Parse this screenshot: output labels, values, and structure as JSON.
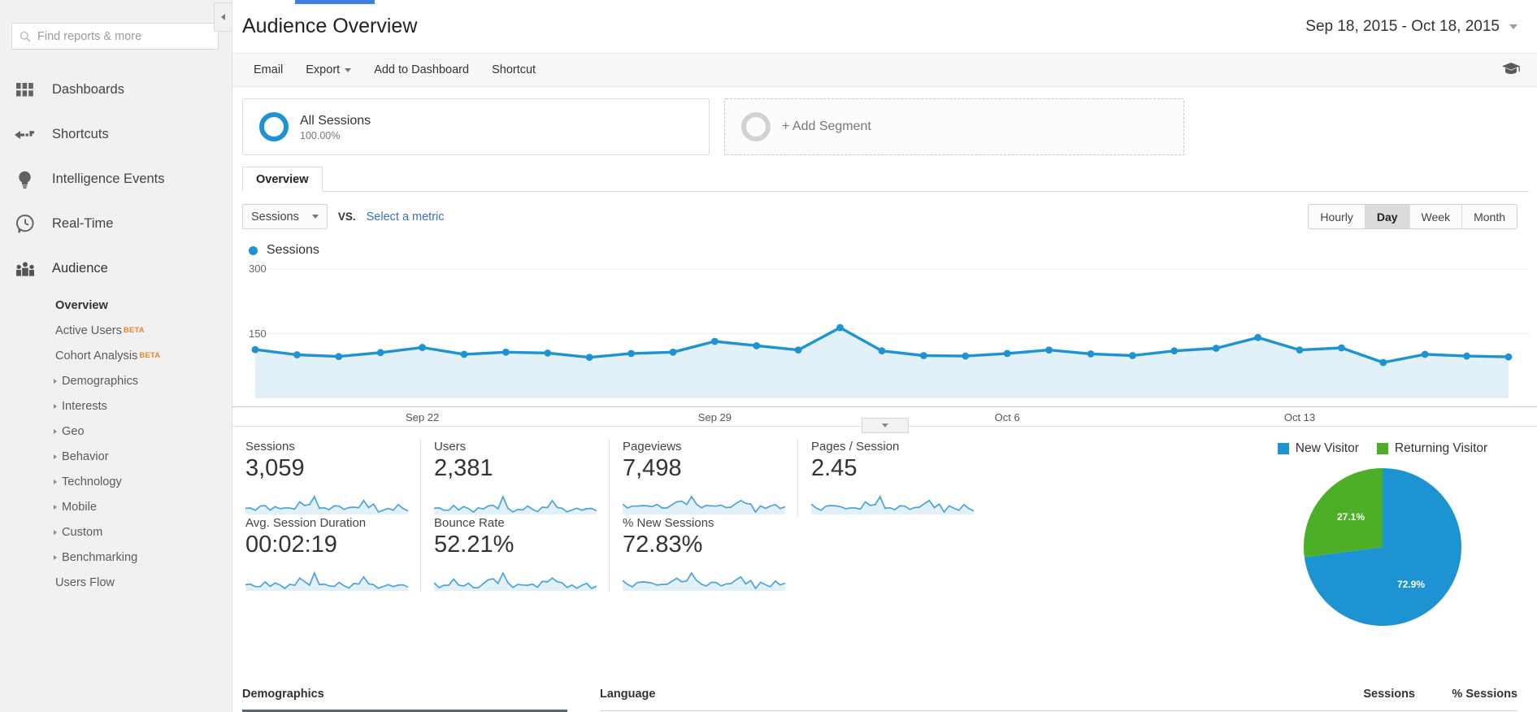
{
  "sidebar": {
    "search": {
      "placeholder": "Find reports & more",
      "value": "",
      "icon": "search-icon"
    },
    "nav": [
      {
        "label": "Dashboards",
        "icon": "grid-icon"
      },
      {
        "label": "Shortcuts",
        "icon": "arrow-left-dashed-icon"
      },
      {
        "label": "Intelligence Events",
        "icon": "lightbulb-icon"
      },
      {
        "label": "Real-Time",
        "icon": "clock-bubble-icon"
      },
      {
        "label": "Audience",
        "icon": "people-icon"
      }
    ],
    "audience_items": [
      {
        "label": "Overview",
        "active": true,
        "beta": "",
        "expandable": false
      },
      {
        "label": "Active Users",
        "active": false,
        "beta": "BETA",
        "expandable": false
      },
      {
        "label": "Cohort Analysis",
        "active": false,
        "beta": "BETA",
        "expandable": false
      },
      {
        "label": "Demographics",
        "active": false,
        "beta": "",
        "expandable": true
      },
      {
        "label": "Interests",
        "active": false,
        "beta": "",
        "expandable": true
      },
      {
        "label": "Geo",
        "active": false,
        "beta": "",
        "expandable": true
      },
      {
        "label": "Behavior",
        "active": false,
        "beta": "",
        "expandable": true
      },
      {
        "label": "Technology",
        "active": false,
        "beta": "",
        "expandable": true
      },
      {
        "label": "Mobile",
        "active": false,
        "beta": "",
        "expandable": true
      },
      {
        "label": "Custom",
        "active": false,
        "beta": "",
        "expandable": true
      },
      {
        "label": "Benchmarking",
        "active": false,
        "beta": "",
        "expandable": true
      },
      {
        "label": "Users Flow",
        "active": false,
        "beta": "",
        "expandable": false
      }
    ]
  },
  "header": {
    "title": "Audience Overview",
    "date_range": "Sep 18, 2015 - Oct 18, 2015",
    "actions": [
      {
        "label": "Email",
        "has_caret": false
      },
      {
        "label": "Export",
        "has_caret": true
      },
      {
        "label": "Add to Dashboard",
        "has_caret": false
      },
      {
        "label": "Shortcut",
        "has_caret": false
      }
    ],
    "help_icon": "graduation-cap-icon"
  },
  "segments": {
    "applied": {
      "name": "All Sessions",
      "percent": "100.00%"
    },
    "add_label": "+ Add Segment"
  },
  "tabs": [
    {
      "label": "Overview",
      "active": true
    }
  ],
  "controls": {
    "metric_selected": "Sessions",
    "vs_label": "VS.",
    "compare_link": "Select a metric",
    "granularity": [
      {
        "label": "Hourly",
        "active": false
      },
      {
        "label": "Day",
        "active": true
      },
      {
        "label": "Week",
        "active": false
      },
      {
        "label": "Month",
        "active": false
      }
    ]
  },
  "chart_data": {
    "type": "line",
    "title": "Sessions",
    "legend": [
      "Sessions"
    ],
    "legend_position": "top-left",
    "xlabel": "",
    "ylabel": "Sessions",
    "ylim": [
      0,
      300
    ],
    "yticks": [
      150,
      300
    ],
    "grid": true,
    "series_color": "#1e93d1",
    "area_fill": "#e2f0f8",
    "x_tick_labels": [
      "Sep 22",
      "Sep 29",
      "Oct 6",
      "Oct 13"
    ],
    "x_tick_indices": [
      4,
      11,
      18,
      25
    ],
    "x": [
      "Sep 18",
      "Sep 19",
      "Sep 20",
      "Sep 21",
      "Sep 22",
      "Sep 23",
      "Sep 24",
      "Sep 25",
      "Sep 26",
      "Sep 27",
      "Sep 28",
      "Sep 29",
      "Sep 30",
      "Oct 1",
      "Oct 2",
      "Oct 3",
      "Oct 4",
      "Oct 5",
      "Oct 6",
      "Oct 7",
      "Oct 8",
      "Oct 9",
      "Oct 10",
      "Oct 11",
      "Oct 12",
      "Oct 13",
      "Oct 14",
      "Oct 15",
      "Oct 16",
      "Oct 17",
      "Oct 18"
    ],
    "values": [
      113,
      101,
      97,
      106,
      118,
      102,
      107,
      105,
      95,
      104,
      107,
      132,
      122,
      112,
      164,
      110,
      99,
      98,
      104,
      112,
      103,
      99,
      110,
      116,
      141,
      112,
      117,
      83,
      102,
      98,
      96
    ]
  },
  "metric_cards": [
    {
      "label": "Sessions",
      "value": "3,059"
    },
    {
      "label": "Users",
      "value": "2,381"
    },
    {
      "label": "Pageviews",
      "value": "7,498"
    },
    {
      "label": "Pages / Session",
      "value": "2.45"
    },
    {
      "label": "Avg. Session Duration",
      "value": "00:02:19"
    },
    {
      "label": "Bounce Rate",
      "value": "52.21%"
    },
    {
      "label": "% New Sessions",
      "value": "72.83%"
    }
  ],
  "visitor_pie": {
    "type": "pie",
    "title": "",
    "categories": [
      "New Visitor",
      "Returning Visitor"
    ],
    "values": [
      72.9,
      27.1
    ],
    "labels": [
      "72.9%",
      "27.1%"
    ],
    "colors": [
      "#1d93d2",
      "#4caf27"
    ]
  },
  "bottom": {
    "left_tab": "Demographics",
    "dimension_header": "Language",
    "col_sessions": "Sessions",
    "col_pct_sessions": "% Sessions"
  }
}
